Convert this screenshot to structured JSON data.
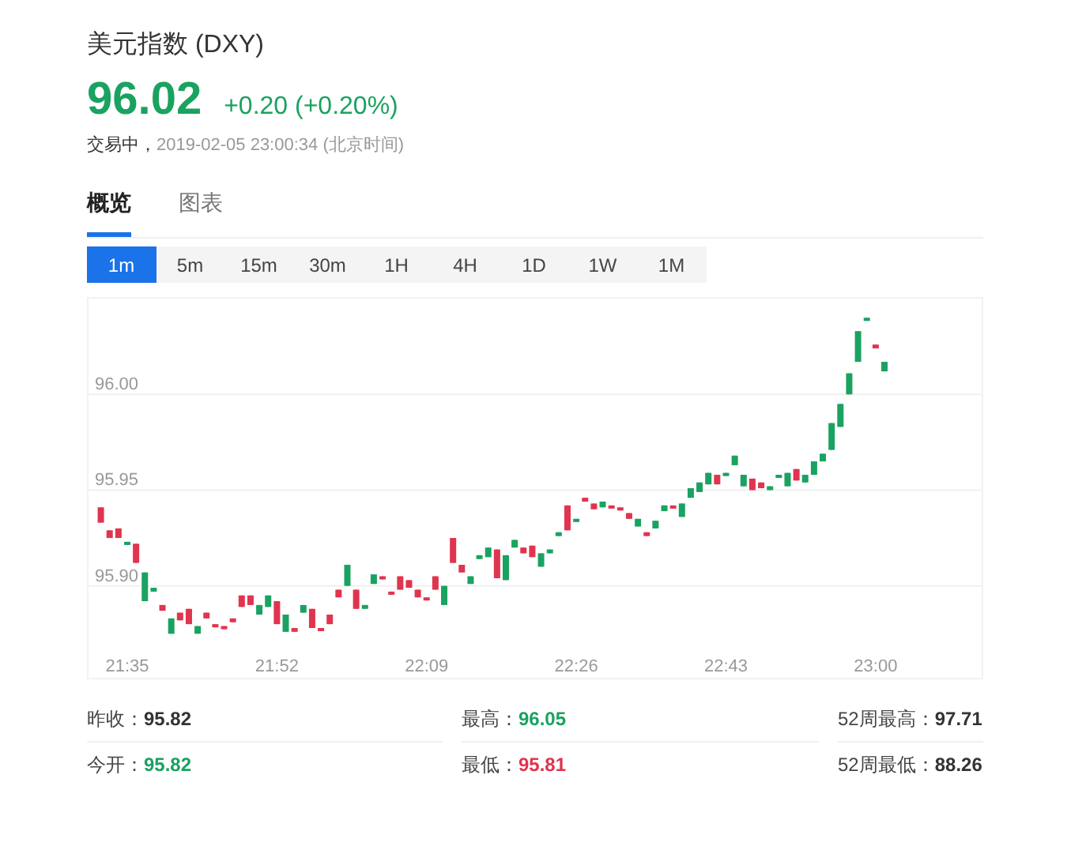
{
  "header": {
    "title": "美元指数 (DXY)",
    "price": "96.02",
    "change": "+0.20 (+0.20%)",
    "status": "交易中，",
    "timestamp": "2019-02-05 23:00:34 (北京时间)"
  },
  "tabs": [
    {
      "label": "概览",
      "selected": true
    },
    {
      "label": "图表",
      "selected": false
    }
  ],
  "periods": [
    {
      "label": "1m",
      "selected": true
    },
    {
      "label": "5m",
      "selected": false
    },
    {
      "label": "15m",
      "selected": false
    },
    {
      "label": "30m",
      "selected": false
    },
    {
      "label": "1H",
      "selected": false
    },
    {
      "label": "4H",
      "selected": false
    },
    {
      "label": "1D",
      "selected": false
    },
    {
      "label": "1W",
      "selected": false
    },
    {
      "label": "1M",
      "selected": false
    }
  ],
  "chart_data": {
    "type": "candlestick",
    "ylim": [
      95.852,
      96.05
    ],
    "grid": true,
    "yticks": [
      {
        "value": 95.9,
        "label": "95.90"
      },
      {
        "value": 95.95,
        "label": "95.95"
      },
      {
        "value": 96.0,
        "label": "96.00"
      }
    ],
    "categories": [
      null,
      null,
      null,
      "21:35",
      null,
      null,
      null,
      null,
      null,
      null,
      null,
      null,
      null,
      null,
      null,
      null,
      null,
      null,
      null,
      null,
      "21:52",
      null,
      null,
      null,
      null,
      null,
      null,
      null,
      null,
      null,
      null,
      null,
      null,
      null,
      null,
      null,
      null,
      "22:09",
      null,
      null,
      null,
      null,
      null,
      null,
      null,
      null,
      null,
      null,
      null,
      null,
      null,
      null,
      null,
      null,
      "22:26",
      null,
      null,
      null,
      null,
      null,
      null,
      null,
      null,
      null,
      null,
      null,
      null,
      null,
      null,
      null,
      null,
      "22:43",
      null,
      null,
      null,
      null,
      null,
      null,
      null,
      null,
      null,
      null,
      null,
      null,
      null,
      null,
      null,
      null,
      "23:00",
      null
    ],
    "series": [
      {
        "ohlc": [
          [
            95.941,
            95.941,
            95.933,
            95.933
          ],
          [
            95.929,
            95.929,
            95.925,
            95.925
          ],
          [
            95.93,
            95.93,
            95.925,
            95.925
          ],
          [
            95.922,
            95.923,
            95.922,
            95.923
          ],
          [
            95.922,
            95.922,
            95.912,
            95.912
          ],
          [
            95.892,
            95.907,
            95.892,
            95.907
          ],
          [
            95.897,
            95.899,
            95.897,
            95.899
          ],
          [
            95.89,
            95.89,
            95.887,
            95.887
          ],
          [
            95.875,
            95.883,
            95.875,
            95.883
          ],
          [
            95.886,
            95.886,
            95.882,
            95.882
          ],
          [
            95.888,
            95.888,
            95.88,
            95.88
          ],
          [
            95.875,
            95.879,
            95.875,
            95.879
          ],
          [
            95.886,
            95.886,
            95.883,
            95.883
          ],
          [
            95.88,
            95.88,
            95.879,
            95.879
          ],
          [
            95.879,
            95.879,
            95.878,
            95.878
          ],
          [
            95.883,
            95.883,
            95.881,
            95.881
          ],
          [
            95.895,
            95.895,
            95.889,
            95.889
          ],
          [
            95.895,
            95.895,
            95.89,
            95.89
          ],
          [
            95.885,
            95.89,
            95.885,
            95.89
          ],
          [
            95.889,
            95.895,
            95.889,
            95.895
          ],
          [
            95.892,
            95.892,
            95.88,
            95.88
          ],
          [
            95.876,
            95.885,
            95.876,
            95.885
          ],
          [
            95.878,
            95.878,
            95.876,
            95.876
          ],
          [
            95.886,
            95.89,
            95.886,
            95.89
          ],
          [
            95.888,
            95.888,
            95.878,
            95.878
          ],
          [
            95.878,
            95.878,
            95.877,
            95.877
          ],
          [
            95.885,
            95.885,
            95.88,
            95.88
          ],
          [
            95.898,
            95.898,
            95.894,
            95.894
          ],
          [
            95.9,
            95.911,
            95.9,
            95.911
          ],
          [
            95.898,
            95.898,
            95.888,
            95.888
          ],
          [
            95.888,
            95.89,
            95.888,
            95.89
          ],
          [
            95.901,
            95.906,
            95.901,
            95.906
          ],
          [
            95.905,
            95.905,
            95.904,
            95.904
          ],
          [
            95.897,
            95.897,
            95.896,
            95.896
          ],
          [
            95.905,
            95.905,
            95.898,
            95.898
          ],
          [
            95.903,
            95.903,
            95.899,
            95.899
          ],
          [
            95.898,
            95.898,
            95.894,
            95.894
          ],
          [
            95.894,
            95.894,
            95.893,
            95.893
          ],
          [
            95.905,
            95.905,
            95.898,
            95.898
          ],
          [
            95.89,
            95.9,
            95.89,
            95.9
          ],
          [
            95.925,
            95.925,
            95.912,
            95.912
          ],
          [
            95.911,
            95.911,
            95.907,
            95.907
          ],
          [
            95.901,
            95.905,
            95.901,
            95.905
          ],
          [
            95.914,
            95.916,
            95.914,
            95.916
          ],
          [
            95.915,
            95.92,
            95.915,
            95.92
          ],
          [
            95.919,
            95.919,
            95.904,
            95.904
          ],
          [
            95.903,
            95.916,
            95.903,
            95.916
          ],
          [
            95.92,
            95.924,
            95.92,
            95.924
          ],
          [
            95.92,
            95.92,
            95.917,
            95.917
          ],
          [
            95.921,
            95.921,
            95.915,
            95.915
          ],
          [
            95.91,
            95.917,
            95.91,
            95.917
          ],
          [
            95.917,
            95.919,
            95.917,
            95.919
          ],
          [
            95.926,
            95.928,
            95.926,
            95.928
          ],
          [
            95.942,
            95.942,
            95.929,
            95.929
          ],
          [
            95.934,
            95.935,
            95.934,
            95.935
          ],
          [
            95.946,
            95.946,
            95.944,
            95.944
          ],
          [
            95.943,
            95.943,
            95.94,
            95.94
          ],
          [
            95.941,
            95.944,
            95.941,
            95.944
          ],
          [
            95.942,
            95.942,
            95.941,
            95.941
          ],
          [
            95.941,
            95.941,
            95.94,
            95.94
          ],
          [
            95.938,
            95.938,
            95.935,
            95.935
          ],
          [
            95.931,
            95.935,
            95.931,
            95.935
          ],
          [
            95.928,
            95.928,
            95.926,
            95.926
          ],
          [
            95.93,
            95.934,
            95.93,
            95.934
          ],
          [
            95.939,
            95.942,
            95.939,
            95.942
          ],
          [
            95.942,
            95.942,
            95.941,
            95.941
          ],
          [
            95.936,
            95.943,
            95.936,
            95.943
          ],
          [
            95.946,
            95.951,
            95.946,
            95.951
          ],
          [
            95.949,
            95.954,
            95.949,
            95.954
          ],
          [
            95.953,
            95.959,
            95.953,
            95.959
          ],
          [
            95.958,
            95.958,
            95.953,
            95.953
          ],
          [
            95.958,
            95.959,
            95.958,
            95.959
          ],
          [
            95.963,
            95.968,
            95.963,
            95.968
          ],
          [
            95.952,
            95.958,
            95.952,
            95.958
          ],
          [
            95.956,
            95.956,
            95.95,
            95.95
          ],
          [
            95.954,
            95.954,
            95.951,
            95.951
          ],
          [
            95.95,
            95.952,
            95.95,
            95.952
          ],
          [
            95.957,
            95.958,
            95.957,
            95.958
          ],
          [
            95.952,
            95.959,
            95.952,
            95.959
          ],
          [
            95.961,
            95.961,
            95.955,
            95.955
          ],
          [
            95.954,
            95.958,
            95.954,
            95.958
          ],
          [
            95.958,
            95.965,
            95.958,
            95.965
          ],
          [
            95.965,
            95.969,
            95.965,
            95.969
          ],
          [
            95.971,
            95.985,
            95.971,
            95.985
          ],
          [
            95.983,
            95.995,
            95.983,
            95.995
          ],
          [
            96.0,
            96.011,
            96.0,
            96.011
          ],
          [
            96.017,
            96.033,
            96.017,
            96.033
          ],
          [
            96.039,
            96.04,
            96.039,
            96.04
          ],
          [
            96.026,
            96.026,
            96.024,
            96.024
          ],
          [
            96.012,
            96.017,
            96.012,
            96.017
          ]
        ]
      }
    ]
  },
  "stats": [
    {
      "label": "昨收：",
      "value": "95.82",
      "color": "#333333"
    },
    {
      "label": "最高：",
      "value": "96.05",
      "color": "#1aa260"
    },
    {
      "label": "52周最高：",
      "value": "97.71",
      "color": "#333333"
    },
    {
      "label": "今开：",
      "value": "95.82",
      "color": "#1aa260"
    },
    {
      "label": "最低：",
      "value": "95.81",
      "color": "#e0344f"
    },
    {
      "label": "52周最低：",
      "value": "88.26",
      "color": "#333333"
    }
  ]
}
